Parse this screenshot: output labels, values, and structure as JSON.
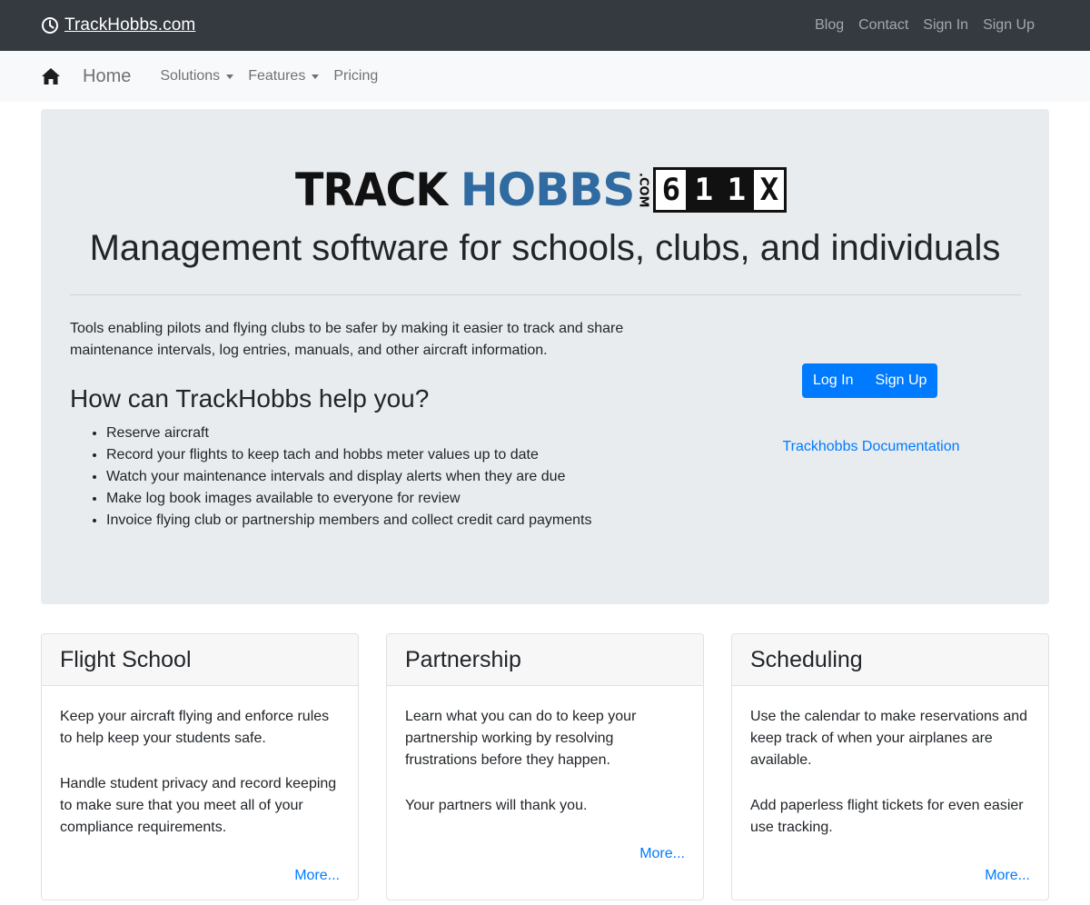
{
  "topbar": {
    "brand": "TrackHobbs.com",
    "links": [
      "Blog",
      "Contact",
      "Sign In",
      "Sign Up"
    ]
  },
  "subnav": {
    "home": "Home",
    "solutions": "Solutions",
    "features": "Features",
    "pricing": "Pricing"
  },
  "hero": {
    "logo": {
      "track": "TRACK",
      "hobbs": "HOBBS",
      "com": ".COM",
      "digits": [
        "6",
        "1",
        "1",
        "X"
      ]
    },
    "headline": "Management software for schools, clubs, and individuals",
    "intro": "Tools enabling pilots and flying clubs to be safer by making it easier to track and share maintenance intervals, log entries, manuals, and other aircraft information.",
    "help_title": "How can TrackHobbs help you?",
    "help_items": [
      "Reserve aircraft",
      "Record your flights to keep tach and hobbs meter values up to date",
      "Watch your maintenance intervals and display alerts when they are due",
      "Make log book images available to everyone for review",
      "Invoice flying club or partnership members and collect credit card payments"
    ],
    "login_label": "Log In",
    "signup_label": "Sign Up",
    "docs_link": "Trackhobbs Documentation"
  },
  "cards": [
    {
      "title": "Flight School",
      "paragraphs": [
        "Keep your aircraft flying and enforce rules to help keep your students safe.",
        "Handle student privacy and record keeping to make sure that you meet all of your compliance requirements."
      ],
      "more": "More..."
    },
    {
      "title": "Partnership",
      "paragraphs": [
        "Learn what you can do to keep your partnership working by resolving frustrations before they happen.",
        "Your partners will thank you."
      ],
      "more": "More..."
    },
    {
      "title": "Scheduling",
      "paragraphs": [
        "Use the calendar to make reservations and keep track of when your airplanes are available.",
        "Add paperless flight tickets for even easier use tracking."
      ],
      "more": "More..."
    }
  ],
  "colors": {
    "topbar_bg": "#343a40",
    "subnav_bg": "#f8f9fa",
    "jumbotron_bg": "#e9ecef",
    "primary": "#007bff",
    "logo_blue": "#2f6aa0"
  }
}
